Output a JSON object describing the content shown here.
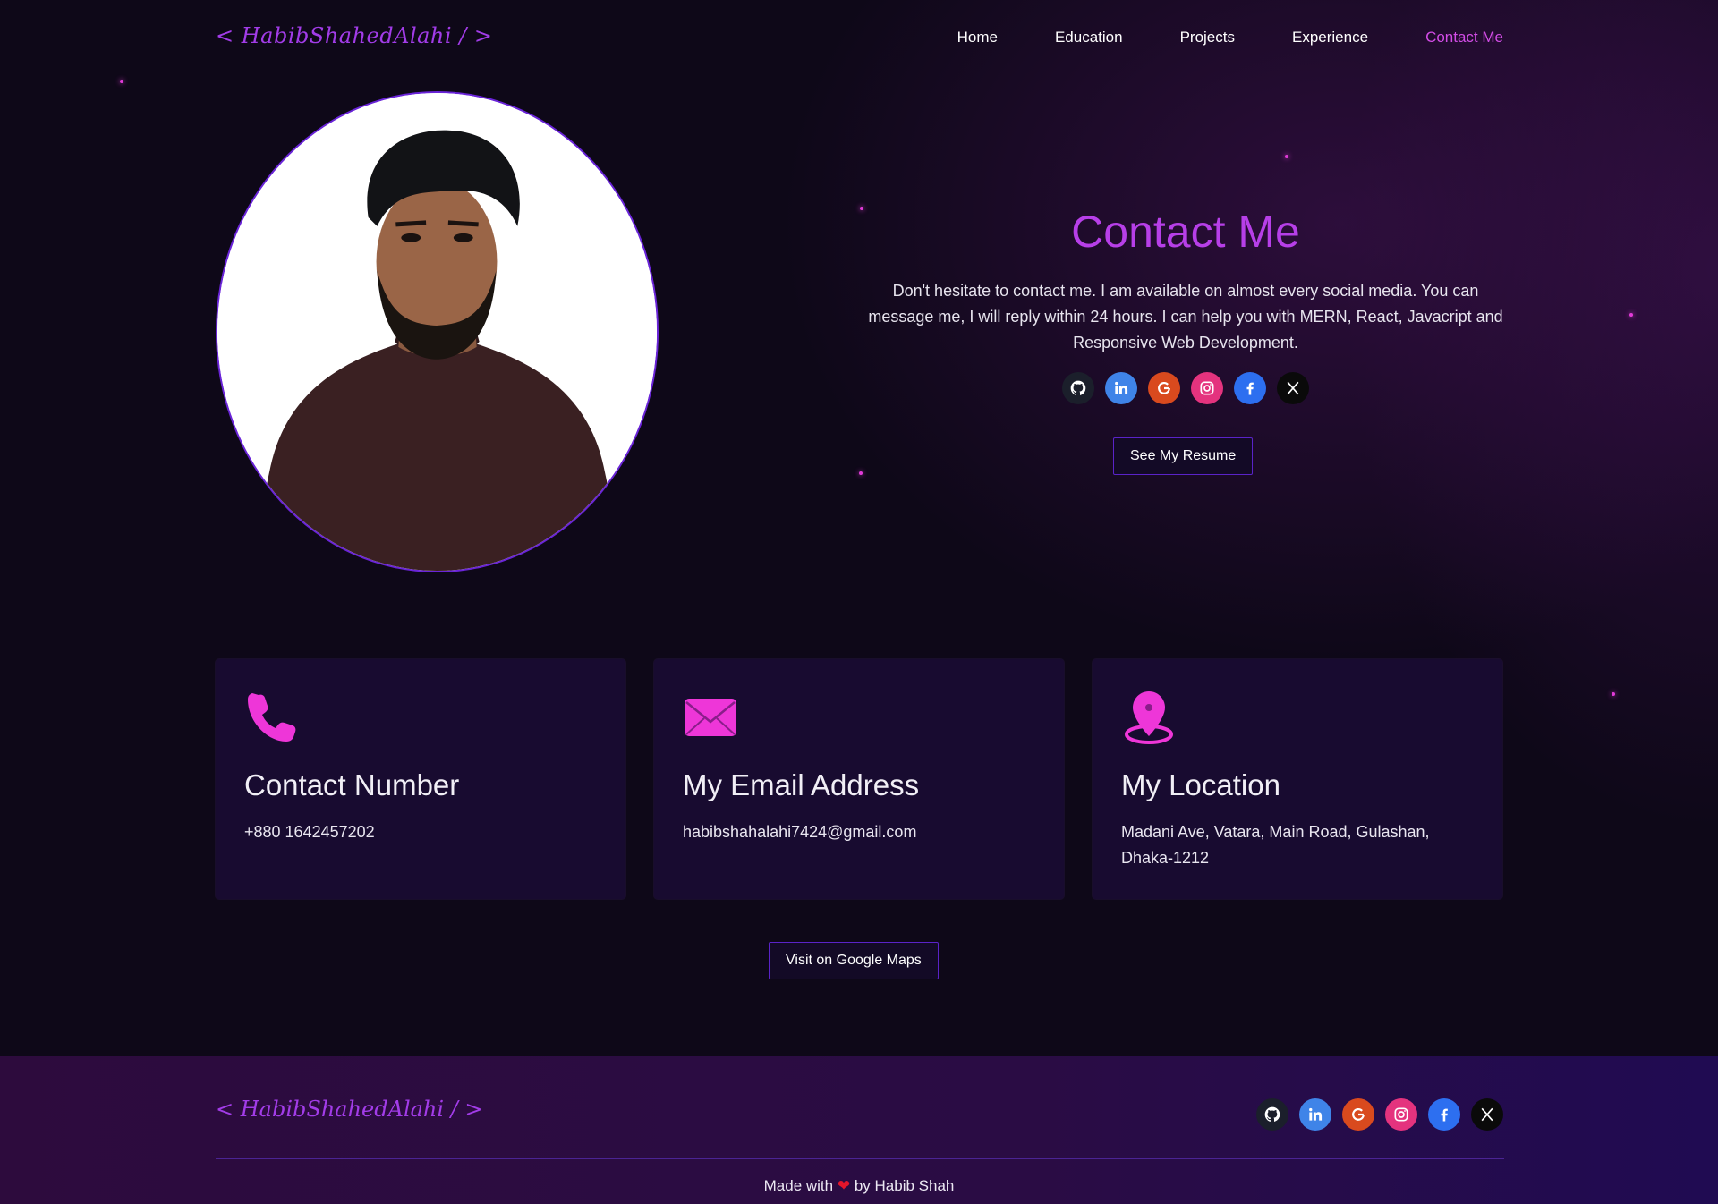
{
  "header": {
    "logo": "< HabibShahedAlahi / >",
    "nav": [
      "Home",
      "Education",
      "Projects",
      "Experience",
      "Contact Me"
    ],
    "active_nav": "Contact Me"
  },
  "hero": {
    "title": "Contact Me",
    "text": "Don't hesitate to contact me. I am available on almost every social media. You can message me, I will reply within 24 hours. I can help you with MERN, React, Javacript and Responsive Web Development.",
    "socials": [
      "github-icon",
      "linkedin-icon",
      "google-icon",
      "instagram-icon",
      "facebook-icon",
      "x-icon"
    ],
    "resume_button": "See My Resume"
  },
  "cards": [
    {
      "icon": "phone-icon",
      "title": "Contact Number",
      "text": "+880 1642457202"
    },
    {
      "icon": "envelope-icon",
      "title": "My Email Address",
      "text": "habibshahalahi7424@gmail.com"
    },
    {
      "icon": "location-pin-icon",
      "title": "My Location",
      "text": "Madani Ave, Vatara, Main Road, Gulashan, Dhaka-1212"
    }
  ],
  "maps_button": "Visit on Google Maps",
  "footer": {
    "logo": "< HabibShahedAlahi / >",
    "made_prefix": "Made with",
    "made_suffix": "by Habib Shah"
  },
  "colors": {
    "accent": "#b73fe8",
    "nav_active": "#d24ce6",
    "icon_pink": "#ee36d8",
    "background": "#0e0818",
    "card": "#180b30"
  }
}
